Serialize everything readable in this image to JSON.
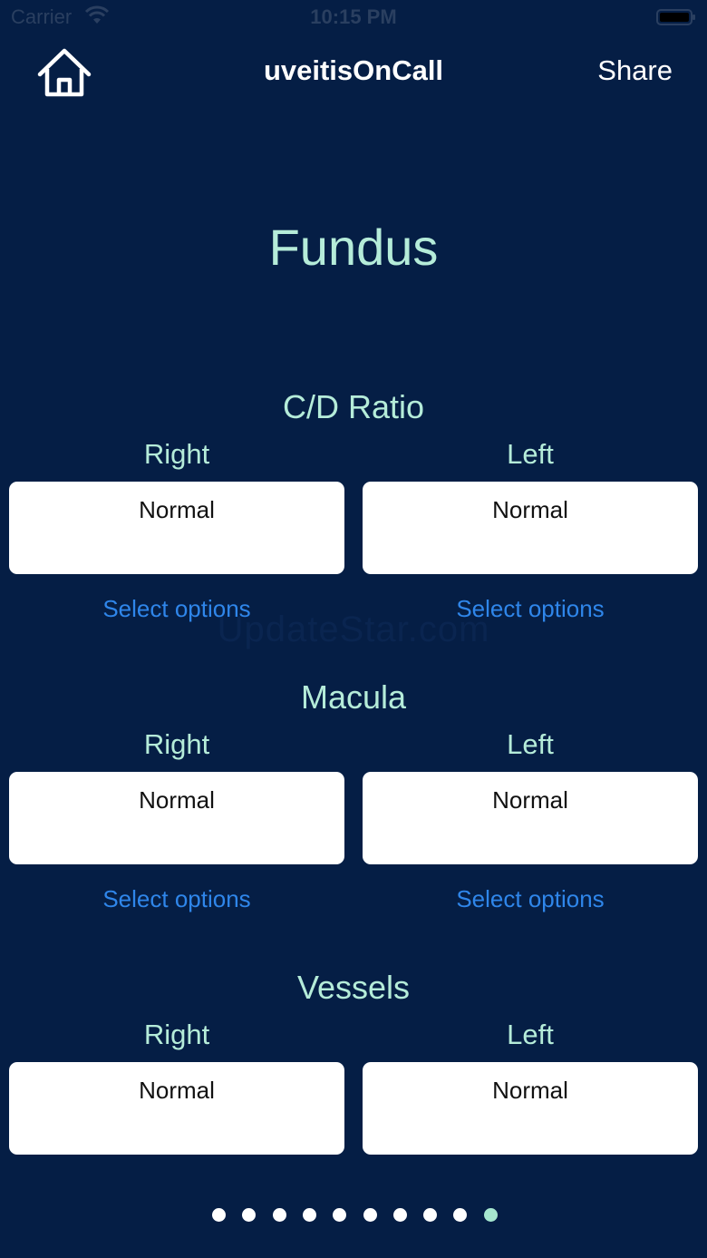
{
  "status_bar": {
    "carrier": "Carrier",
    "time": "10:15 PM"
  },
  "nav": {
    "home_icon": "home-icon",
    "title": "uveitisOnCall",
    "share_label": "Share"
  },
  "page": {
    "title": "Fundus"
  },
  "watermark": "UpdateStar.com",
  "sections": [
    {
      "title": "C/D Ratio",
      "right_label": "Right",
      "left_label": "Left",
      "right_value": "Normal",
      "left_value": "Normal",
      "right_select": "Select options",
      "left_select": "Select options"
    },
    {
      "title": "Macula",
      "right_label": "Right",
      "left_label": "Left",
      "right_value": "Normal",
      "left_value": "Normal",
      "right_select": "Select options",
      "left_select": "Select options"
    },
    {
      "title": "Vessels",
      "right_label": "Right",
      "left_label": "Left",
      "right_value": "Normal",
      "left_value": "Normal"
    }
  ],
  "pagination": {
    "total": 10,
    "current": 10
  },
  "colors": {
    "background": "#051e45",
    "accent_text": "#b5ecd9",
    "link": "#2f86ea",
    "active_dot": "#a6e7cf"
  }
}
